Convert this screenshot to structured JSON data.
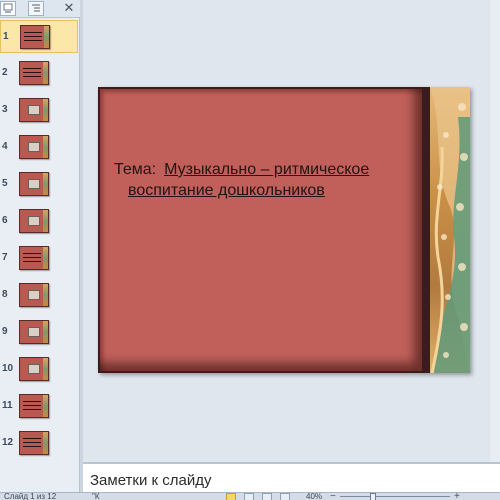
{
  "pane": {
    "tab_slides_icon": "slides-tab-icon",
    "tab_outline_icon": "outline-tab-icon",
    "close_glyph": "✕"
  },
  "thumbnails": [
    {
      "number": "1",
      "selected": true
    },
    {
      "number": "2"
    },
    {
      "number": "3"
    },
    {
      "number": "4"
    },
    {
      "number": "5"
    },
    {
      "number": "6"
    },
    {
      "number": "7"
    },
    {
      "number": "8"
    },
    {
      "number": "9"
    },
    {
      "number": "10"
    },
    {
      "number": "11"
    },
    {
      "number": "12"
    }
  ],
  "slide": {
    "label": "Тема:",
    "title_line1": "Музыкально – ритмическое",
    "title_line2": "воспитание  дошкольников"
  },
  "notes": {
    "placeholder": "Заметки к слайду"
  },
  "statusbar": {
    "slide_info": "Слайд 1 из 12",
    "theme_name": "\"К",
    "zoom": "40%",
    "zoom_minus": "−",
    "zoom_plus": "+"
  },
  "colors": {
    "slide_bg": "#c1605a",
    "selection": "#fbe8a8",
    "title_text": "#231312"
  }
}
